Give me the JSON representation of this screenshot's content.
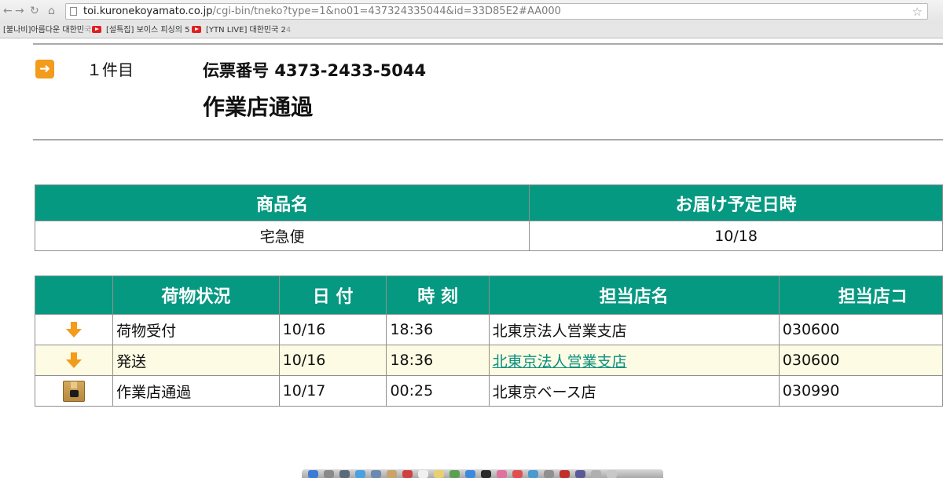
{
  "browser": {
    "url_host": "toi.kuronekoyamato.co.jp",
    "url_rest": "/cgi-bin/tneko?type=1&no01=437324335044&id=33D85E2#AA000",
    "bookmarks": [
      {
        "label": "[불나비]아름다운 대한민",
        "fade": "국"
      },
      {
        "label": "[설특집] 보이스 피싱의 5",
        "fade": ""
      },
      {
        "label": "[YTN LIVE] 대한민국 2",
        "fade": "4"
      }
    ]
  },
  "tracking": {
    "count_label": "１件目",
    "slip_label": "伝票番号",
    "slip_number": "4373-2433-5044",
    "status_title": "作業店通過"
  },
  "summary_table": {
    "headers": [
      "商品名",
      "お届け予定日時"
    ],
    "row": [
      "宅急便",
      "10/18"
    ]
  },
  "status_table": {
    "headers": [
      "",
      "荷物状況",
      "日 付",
      "時 刻",
      "担当店名",
      "担当店コ"
    ],
    "rows": [
      {
        "icon": "down-arrow-icon",
        "status": "荷物受付",
        "date": "10/16",
        "time": "18:36",
        "store": "北東京法人営業支店",
        "code": "030600",
        "store_link": false
      },
      {
        "icon": "down-arrow-icon",
        "status": "発送",
        "date": "10/16",
        "time": "18:36",
        "store": "北東京法人営業支店",
        "code": "030600",
        "store_link": true
      },
      {
        "icon": "package-box-icon",
        "status": "作業店通過",
        "date": "10/17",
        "time": "00:25",
        "store": "北東京ベース店",
        "code": "030990",
        "store_link": false
      }
    ]
  },
  "colors": {
    "header_green": "#069981",
    "accent_orange": "#f39b1a",
    "link_teal": "#0a8f80",
    "alt_row": "#fdfbe3"
  }
}
